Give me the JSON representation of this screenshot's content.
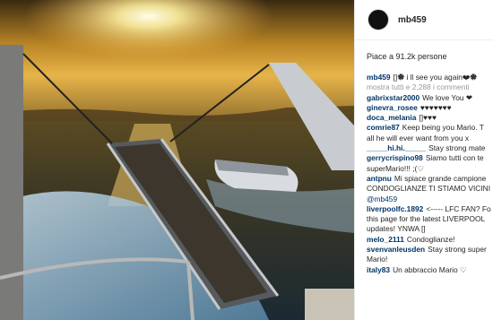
{
  "post": {
    "photo_alt": "Boat deck with gangway at sunset over the sea",
    "username": "mb459",
    "likes": "Piace a 91.2k persone",
    "caption": {
      "user": "mb459",
      "text": "[]🏶 i ll see you again❤🏶"
    },
    "more_comments": "mostra tutti e 2,288 i commenti"
  },
  "comments": [
    {
      "user": "gabrixstar2000",
      "text": "We love You ❤"
    },
    {
      "user": "ginevra_rosee",
      "text": "♥♥♥♥♥♥♥"
    },
    {
      "user": "doca_melania",
      "text": "[]♥♥♥"
    },
    {
      "user": "comrie87",
      "text": "Keep being you Mario. T",
      "line2": "all he will ever want from you x"
    },
    {
      "user": "_____hi.hi._____",
      "text": "Stay strong mate"
    },
    {
      "user": "gerrycrispino98",
      "text": "Siamo tutti con te",
      "line2": "superMario!!! ;(♡"
    },
    {
      "user": "antpnu",
      "text": "Mi spiace grande campione",
      "line2": "CONDOGLIANZE TI STIAMO VICINI",
      "mention": "@mb459"
    },
    {
      "user": "liverpoolfc.1892",
      "text": "<----- LFC FAN? Fo",
      "line2": "this page for the latest LIVERPOOL",
      "line3": "updates! YNWA []"
    },
    {
      "user": "melo_2111",
      "text": "Condoglianze!"
    },
    {
      "user": "svenvanleusden",
      "text": "Stay strong super",
      "line2": "Mario!"
    },
    {
      "user": "italy83",
      "text": "Un abbraccio Mario ♡"
    }
  ]
}
